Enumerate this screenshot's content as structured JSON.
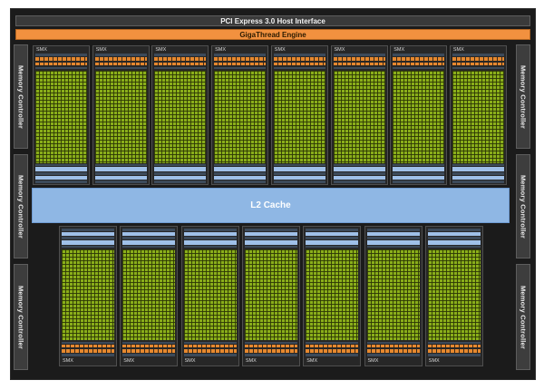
{
  "diagram": {
    "host_interface": "PCI Express 3.0 Host Interface",
    "scheduler": "GigaThread Engine",
    "l2_cache": "L2 Cache",
    "memory_controllers": [
      "Memory Controller",
      "Memory Controller",
      "Memory Controller",
      "Memory Controller",
      "Memory Controller",
      "Memory Controller"
    ],
    "smx_top": [
      "SMX",
      "SMX",
      "SMX",
      "SMX",
      "SMX",
      "SMX",
      "SMX",
      "SMX"
    ],
    "smx_bottom": [
      "SMX",
      "SMX",
      "SMX",
      "SMX",
      "SMX",
      "SMX",
      "SMX"
    ]
  },
  "colors": {
    "background": "#1b1b1b",
    "scheduler": "#f2913f",
    "l2_cache": "#8fb7e4",
    "cuda_cores": "#8aae1a",
    "memory_controller": "#3d3d3d"
  }
}
